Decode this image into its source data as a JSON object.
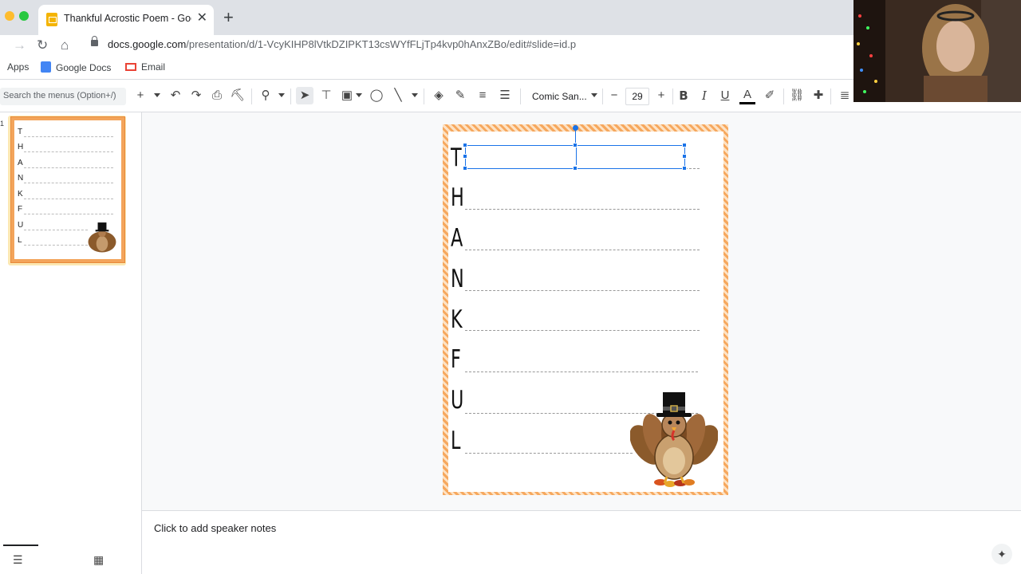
{
  "browser": {
    "tab_title": "Thankful Acrostic Poem - Goo",
    "url_host": "docs.google.com",
    "url_path": "/presentation/d/1-VcyKIHP8lVtkDZIPKT13csWYfFLjTp4kvp0hAnxZBo/edit#slide=id.p",
    "bookmarks": [
      "Apps",
      "Google Docs",
      "Email"
    ]
  },
  "toolbar": {
    "search_placeholder": "Search the menus (Option+/)",
    "font_name": "Comic San...",
    "font_size": "29"
  },
  "filmstrip": {
    "slide_number": "1",
    "letters": [
      "T",
      "H",
      "A",
      "N",
      "K",
      "F",
      "U",
      "L"
    ]
  },
  "slide": {
    "letters": [
      "T",
      "H",
      "A",
      "N",
      "K",
      "F",
      "U",
      "L"
    ]
  },
  "notes": {
    "placeholder": "Click to add speaker notes"
  },
  "colors": {
    "border_orange": "#f39a4e",
    "selection_blue": "#1a73e8",
    "thumb_highlight": "#fce8b2"
  }
}
